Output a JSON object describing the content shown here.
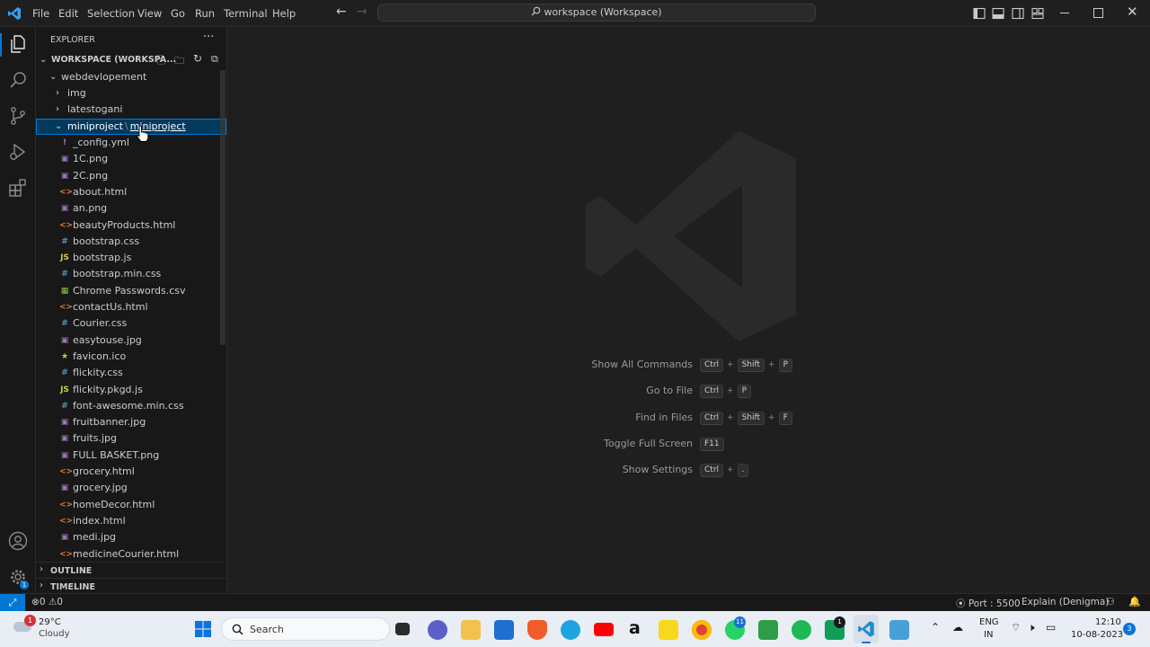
{
  "menu": [
    "File",
    "Edit",
    "Selection",
    "View",
    "Go",
    "Run",
    "Terminal",
    "Help"
  ],
  "search": {
    "text": "workspace (Workspace)"
  },
  "explorer": {
    "title": "EXPLORER",
    "more": "···",
    "workspace_label": "WORKSPACE (WORKSPA...",
    "root_folder": "webdevlopement",
    "folders": [
      "img",
      "latestogani"
    ],
    "selected_folder_a": "miniproject",
    "selected_folder_sep": "\\",
    "selected_folder_b": "miniproject",
    "files": [
      {
        "name": "_config.yml",
        "icon": "!",
        "color": "#a074c4"
      },
      {
        "name": "1C.png",
        "icon": "▣",
        "color": "#a074c4"
      },
      {
        "name": "2C.png",
        "icon": "▣",
        "color": "#a074c4"
      },
      {
        "name": "about.html",
        "icon": "<>",
        "color": "#e37933"
      },
      {
        "name": "an.png",
        "icon": "▣",
        "color": "#a074c4"
      },
      {
        "name": "beautyProducts.html",
        "icon": "<>",
        "color": "#e37933"
      },
      {
        "name": "bootstrap.css",
        "icon": "#",
        "color": "#519aba"
      },
      {
        "name": "bootstrap.js",
        "icon": "JS",
        "color": "#cbcb41"
      },
      {
        "name": "bootstrap.min.css",
        "icon": "#",
        "color": "#519aba"
      },
      {
        "name": "Chrome Passwords.csv",
        "icon": "▦",
        "color": "#8dc149"
      },
      {
        "name": "contactUs.html",
        "icon": "<>",
        "color": "#e37933"
      },
      {
        "name": "Courier.css",
        "icon": "#",
        "color": "#519aba"
      },
      {
        "name": "easytouse.jpg",
        "icon": "▣",
        "color": "#a074c4"
      },
      {
        "name": "favicon.ico",
        "icon": "★",
        "color": "#cbcb41"
      },
      {
        "name": "flickity.css",
        "icon": "#",
        "color": "#519aba"
      },
      {
        "name": "flickity.pkgd.js",
        "icon": "JS",
        "color": "#cbcb41"
      },
      {
        "name": "font-awesome.min.css",
        "icon": "#",
        "color": "#519aba"
      },
      {
        "name": "fruitbanner.jpg",
        "icon": "▣",
        "color": "#a074c4"
      },
      {
        "name": "fruits.jpg",
        "icon": "▣",
        "color": "#a074c4"
      },
      {
        "name": "FULL BASKET.png",
        "icon": "▣",
        "color": "#a074c4"
      },
      {
        "name": "grocery.html",
        "icon": "<>",
        "color": "#e37933"
      },
      {
        "name": "grocery.jpg",
        "icon": "▣",
        "color": "#a074c4"
      },
      {
        "name": "homeDecor.html",
        "icon": "<>",
        "color": "#e37933"
      },
      {
        "name": "index.html",
        "icon": "<>",
        "color": "#e37933"
      },
      {
        "name": "medi.jpg",
        "icon": "▣",
        "color": "#a074c4"
      },
      {
        "name": "medicineCourier.html",
        "icon": "<>",
        "color": "#e37933"
      }
    ],
    "outline": "OUTLINE",
    "timeline": "TIMELINE"
  },
  "hints": [
    {
      "label": "Show All Commands",
      "keys": [
        "Ctrl",
        "Shift",
        "P"
      ]
    },
    {
      "label": "Go to File",
      "keys": [
        "Ctrl",
        "P"
      ]
    },
    {
      "label": "Find in Files",
      "keys": [
        "Ctrl",
        "Shift",
        "F"
      ]
    },
    {
      "label": "Toggle Full Screen",
      "keys": [
        "F11"
      ]
    },
    {
      "label": "Show Settings",
      "keys": [
        "Ctrl",
        "."
      ]
    }
  ],
  "status": {
    "errors": "0",
    "warnings": "0",
    "port": "Port : 5500",
    "explain": "Explain (Denigma)"
  },
  "taskbar": {
    "weather_temp": "29°C",
    "weather_desc": "Cloudy",
    "weather_badge": "1",
    "search": "Search",
    "lang1": "ENG",
    "lang2": "IN",
    "time": "12:10",
    "date": "10-08-2023",
    "notif": "3",
    "whatsapp_badge": "11",
    "chat_badge": "1"
  },
  "colors": {
    "accent": "#0078d4",
    "selected_bg": "#04395e"
  }
}
